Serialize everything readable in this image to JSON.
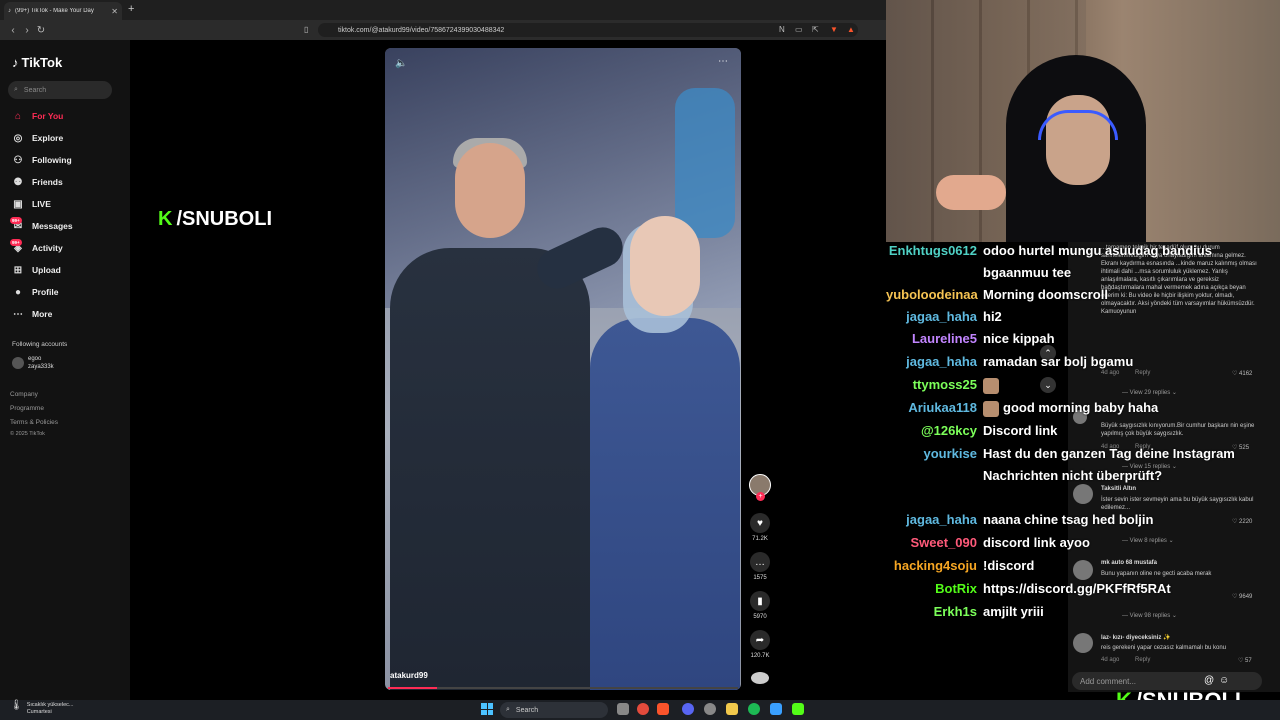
{
  "browser": {
    "tab_title": "(99+) TikTok - Make Your Day",
    "url": "tiktok.com/@atakurd99/video/7586724399030488342"
  },
  "sidebar": {
    "logo": "TikTok",
    "search_placeholder": "Search",
    "items": [
      {
        "label": "For You",
        "icon": "home-icon"
      },
      {
        "label": "Explore",
        "icon": "compass-icon"
      },
      {
        "label": "Following",
        "icon": "users-icon"
      },
      {
        "label": "Friends",
        "icon": "friends-icon"
      },
      {
        "label": "LIVE",
        "icon": "live-icon"
      },
      {
        "label": "Messages",
        "icon": "message-icon",
        "badge": "99+"
      },
      {
        "label": "Activity",
        "icon": "activity-icon",
        "badge": "99+"
      },
      {
        "label": "Upload",
        "icon": "upload-icon"
      },
      {
        "label": "Profile",
        "icon": "profile-icon"
      },
      {
        "label": "More",
        "icon": "more-icon"
      }
    ],
    "following_accounts_label": "Following accounts",
    "account": {
      "name": "egoo",
      "handle": "zaya333k"
    },
    "footer": [
      "Company",
      "Programme",
      "Terms & Policies",
      "© 2025 TikTok"
    ]
  },
  "video": {
    "username": "atakurd99",
    "progress": 0.14,
    "actions": {
      "likes": "71.2K",
      "comments": "1575",
      "saves": "5970",
      "shares": "120.7K"
    }
  },
  "webcam": {
    "handle": "/SNUBOLI"
  },
  "chat": [
    {
      "user": "Enkhtugs0612",
      "color": "#4fd1c5",
      "msg": "odoo hurtel mungu asuudag bandius bgaanmuu tee"
    },
    {
      "user": "yuboloodeinaa",
      "color": "#f6c453",
      "msg": "Morning doomscroll"
    },
    {
      "user": "jagaa_haha",
      "color": "#5fb9e0",
      "msg": "hi2"
    },
    {
      "user": "Laureline5",
      "color": "#c285ff",
      "msg": "nice kippah"
    },
    {
      "user": "jagaa_haha",
      "color": "#5fb9e0",
      "msg": "ramadan sar bolj bgamu"
    },
    {
      "user": "ttymoss25",
      "color": "#7cff5a",
      "msg": "",
      "emote": true
    },
    {
      "user": "Ariukaa118",
      "color": "#5fb9e0",
      "msg": "good morning baby haha",
      "emote": true
    },
    {
      "user": "@126kcy",
      "color": "#7cff5a",
      "msg": "Discord link"
    },
    {
      "user": "yourkise",
      "color": "#5fb9e0",
      "msg": "Hast du den ganzen Tag deine Instagram Nachrichten nicht überprüft?"
    },
    {
      "user": "jagaa_haha",
      "color": "#5fb9e0",
      "msg": "naana chine tsag hed boljin"
    },
    {
      "user": "Sweet_090",
      "color": "#ff5a7a",
      "msg": "discord link ayoo"
    },
    {
      "user": "hacking4soju",
      "color": "#f6a623",
      "msg": "!discord"
    },
    {
      "user": "BotRix",
      "color": "#53fc18",
      "msg": "https://discord.gg/PKFfRf5RAt"
    },
    {
      "user": "Erkh1s",
      "color": "#7cff5a",
      "msg": "amjilt yriii"
    }
  ],
  "comments": {
    "c1_text": "...tamamen teknik bir tesadüf olup, bu durum sahnelenmediğim veya onayladığım anlamına gelmez. Ekranı kaydırma esnasında ...kinde maruz kalınmış olması ihtimali dahi ...msa sorumluluk yüklemez. Yanlış anlaşılmalara, kasıtlı çıkarımlara ve gereksiz bağdaştırmalara mahal vermemek adına açıkça beyan ederim ki: Bu video ile hiçbir ilişkim yoktur, olmadı, olmayacaktır. Aksi yöndeki tüm varsayımlar hükümsüzdür. Kamuoyunun",
    "c1_meta": "4d ago",
    "c1_reply": "Reply",
    "c1_likes": "4162",
    "c1_view": "View 29 replies",
    "c2_text": "Büyük saygısızlık kınıyorum.Bir cumhur başkanı nin eşine yapılmış çok büyük saygısızlık.",
    "c2_meta": "4d ago",
    "c2_reply": "Reply",
    "c2_likes": "525",
    "c2_view": "View 15 replies",
    "c3_name": "Taksitli Altın",
    "c3_text": "İster sevin ister sevmeyin ama bu büyük saygısızlık kabul edilemez...",
    "c3_likes": "2220",
    "c3_view": "View 8 replies",
    "c4_name": "mk auto 68 mustafa",
    "c4_text": "Bunu yapanın oline ne gecti acaba merak",
    "c4_likes": "9649",
    "c4_view": "View 98 replies",
    "c5_name": "laz- kızı- diyeceksiniz ✨",
    "c5_text": "reis gerekeni yapar cezasız kalmamalı bu konu",
    "c5_meta": "4d ago",
    "c5_reply": "Reply",
    "c5_likes": "57",
    "add_placeholder": "Add comment..."
  },
  "bottom_handle": "/SNUBOLI",
  "taskbar": {
    "weather_line1": "Sıcaklık yükselec...",
    "weather_line2": "Cumartesi",
    "search": "Search"
  }
}
